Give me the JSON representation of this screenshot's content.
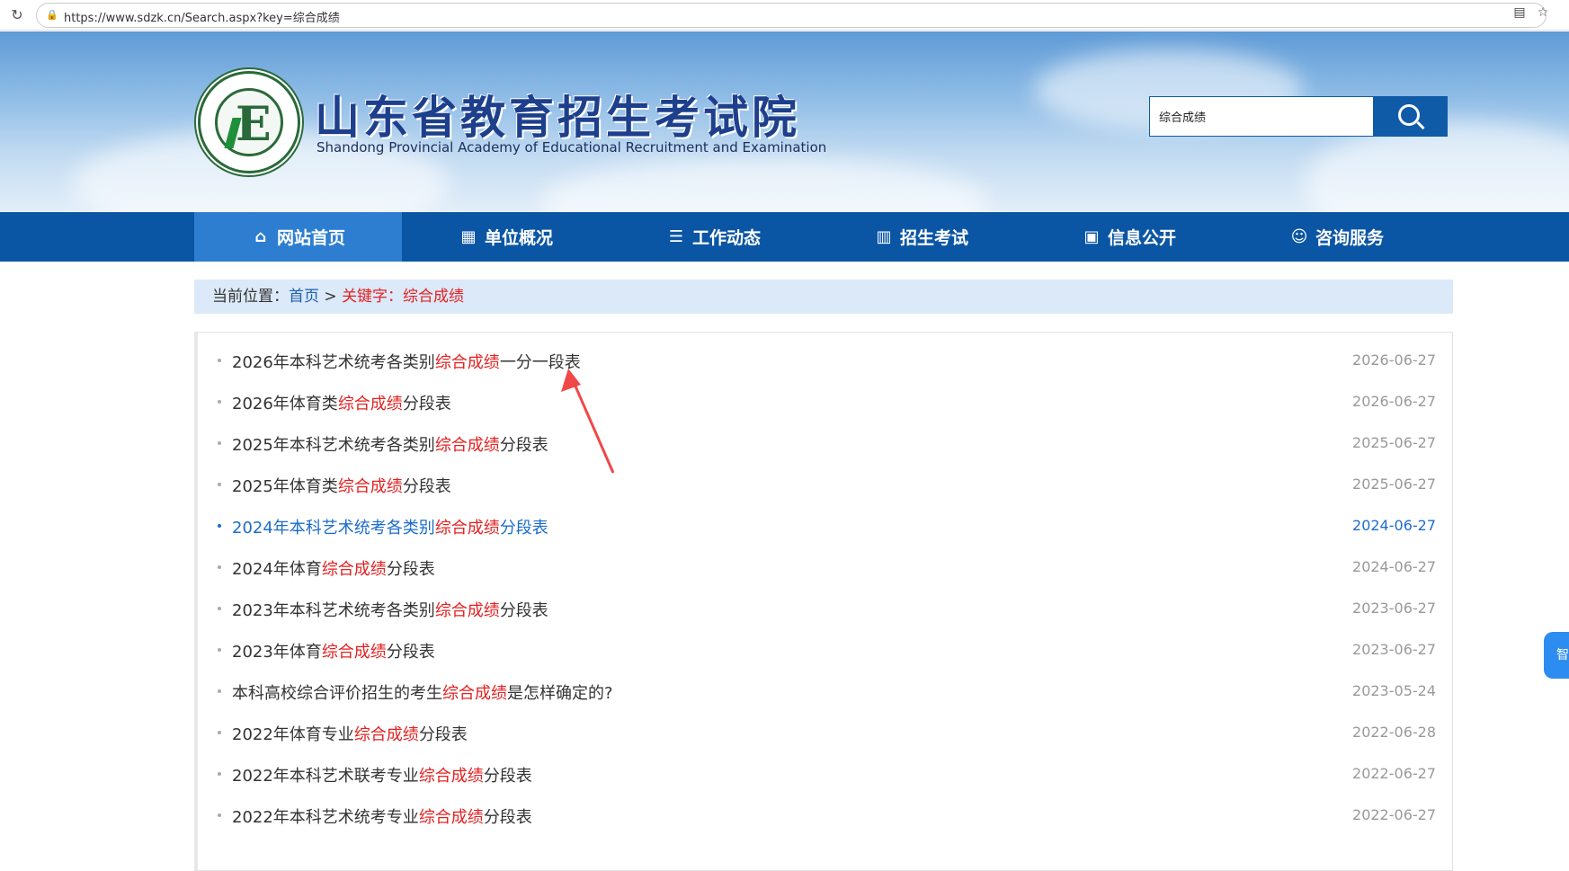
{
  "browser": {
    "url": "https://www.sdzk.cn/Search.aspx?key=综合成绩",
    "reload_icon": "reload-icon",
    "lock_icon": "lock-icon",
    "reader_icon": "reader-icon",
    "star_icon": "star-icon"
  },
  "header": {
    "title": "山东省教育招生考试院",
    "subtitle": "Shandong Provincial Academy of Educational Recruitment and Examination",
    "logo_letter": "E",
    "search_value": "综合成绩"
  },
  "nav": [
    {
      "label": "网站首页",
      "icon": "home-icon",
      "active": true
    },
    {
      "label": "单位概况",
      "icon": "building-icon",
      "active": false
    },
    {
      "label": "工作动态",
      "icon": "server-icon",
      "active": false
    },
    {
      "label": "招生考试",
      "icon": "book-icon",
      "active": false
    },
    {
      "label": "信息公开",
      "icon": "briefcase-icon",
      "active": false
    },
    {
      "label": "咨询服务",
      "icon": "support-icon",
      "active": false
    }
  ],
  "breadcrumb": {
    "prefix": "当前位置：",
    "home": "首页",
    "sep": ">",
    "keyword_label": "关键字：综合成绩"
  },
  "results": [
    {
      "pre": "2026年本科艺术统考各类别",
      "kw": "综合成绩",
      "post": "一分一段表",
      "date": "2026-06-27",
      "hl": false
    },
    {
      "pre": "2026年体育类",
      "kw": "综合成绩",
      "post": "分段表",
      "date": "2026-06-27",
      "hl": false
    },
    {
      "pre": "2025年本科艺术统考各类别",
      "kw": "综合成绩",
      "post": "分段表",
      "date": "2025-06-27",
      "hl": false
    },
    {
      "pre": "2025年体育类",
      "kw": "综合成绩",
      "post": "分段表",
      "date": "2025-06-27",
      "hl": false
    },
    {
      "pre": "2024年本科艺术统考各类别",
      "kw": "综合成绩",
      "post": "分段表",
      "date": "2024-06-27",
      "hl": true
    },
    {
      "pre": "2024年体育",
      "kw": "综合成绩",
      "post": "分段表",
      "date": "2024-06-27",
      "hl": false
    },
    {
      "pre": "2023年本科艺术统考各类别",
      "kw": "综合成绩",
      "post": "分段表",
      "date": "2023-06-27",
      "hl": false
    },
    {
      "pre": "2023年体育",
      "kw": "综合成绩",
      "post": "分段表",
      "date": "2023-06-27",
      "hl": false
    },
    {
      "pre": "本科高校综合评价招生的考生",
      "kw": "综合成绩",
      "post": "是怎样确定的?",
      "date": "2023-05-24",
      "hl": false
    },
    {
      "pre": "2022年体育专业",
      "kw": "综合成绩",
      "post": "分段表",
      "date": "2022-06-28",
      "hl": false
    },
    {
      "pre": "2022年本科艺术联考专业",
      "kw": "综合成绩",
      "post": "分段表",
      "date": "2022-06-27",
      "hl": false
    },
    {
      "pre": "2022年本科艺术统考专业",
      "kw": "综合成绩",
      "post": "分段表",
      "date": "2022-06-27",
      "hl": false
    }
  ],
  "float_tab": "智",
  "colors": {
    "nav_bg": "#0b56a4",
    "nav_active": "#2d7ed0",
    "keyword_red": "#e42121",
    "link_blue": "#1c6ccc",
    "annotation_arrow": "#f04848"
  }
}
